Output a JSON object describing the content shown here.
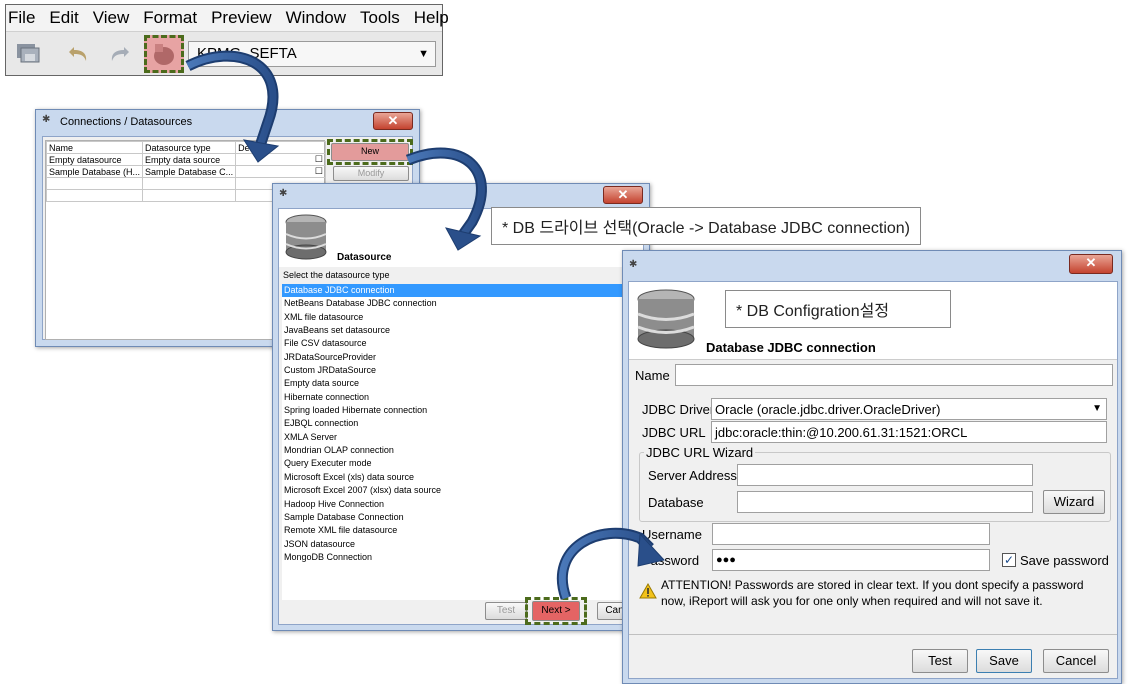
{
  "menu": [
    "File",
    "Edit",
    "View",
    "Format",
    "Preview",
    "Window",
    "Tools",
    "Help"
  ],
  "toolbar": {
    "datasource_selected": "KPMG_SEFTA",
    "icons": [
      "save-icon",
      "undo-icon",
      "redo-icon",
      "datasource-connections-icon"
    ]
  },
  "connections_window": {
    "title": "Connections / Datasources",
    "columns": [
      "Name",
      "Datasource type",
      "Default"
    ],
    "rows": [
      {
        "name": "Empty datasource",
        "type": "Empty data source"
      },
      {
        "name": "Sample Database (H...",
        "type": "Sample Database C..."
      }
    ],
    "new_button": "New",
    "modify_button": "Modify"
  },
  "datasource_window": {
    "header": "Datasource",
    "instruction": "Select the datasource type",
    "types": [
      "Database JDBC connection",
      "NetBeans Database JDBC connection",
      "XML file datasource",
      "JavaBeans set datasource",
      "File CSV datasource",
      "JRDataSourceProvider",
      "Custom JRDataSource",
      "Empty data source",
      "Hibernate connection",
      "Spring loaded Hibernate connection",
      "EJBQL connection",
      "XMLA Server",
      "Mondrian OLAP connection",
      "Query Executer mode",
      "Microsoft Excel (xls) data source",
      "Microsoft Excel 2007 (xlsx) data source",
      "Hadoop Hive Connection",
      "Sample Database Connection",
      "Remote XML file datasource",
      "JSON datasource",
      "MongoDB Connection"
    ],
    "test_button": "Test",
    "next_button": "Next >",
    "cancel_button": "Canc"
  },
  "callouts": {
    "select_driver": "* DB 드라이브 선택(Oracle -> Database JDBC connection)",
    "config": "* DB Configration설정"
  },
  "jdbc_window": {
    "header": "Database JDBC connection",
    "name_label": "Name",
    "name_value": "",
    "driver_label": "JDBC Driver",
    "driver_value": "Oracle (oracle.jdbc.driver.OracleDriver)",
    "url_label": "JDBC URL",
    "url_value": "jdbc:oracle:thin:@10.200.61.31:1521:ORCL",
    "wizard_group": "JDBC URL Wizard",
    "server_label": "Server Address",
    "server_value": "",
    "database_label": "Database",
    "database_value": "",
    "wizard_button": "Wizard",
    "username_label": "Username",
    "username_value": "",
    "password_label": "Password",
    "password_value": "●●●",
    "save_password_label": "Save password",
    "save_password_checked": true,
    "attention_line1": "ATTENTION! Passwords are stored in clear text. If you dont specify a password",
    "attention_line2": "now, iReport will ask you for one only when required and will not save it.",
    "test_button": "Test",
    "save_button": "Save",
    "cancel_button": "Cancel"
  }
}
